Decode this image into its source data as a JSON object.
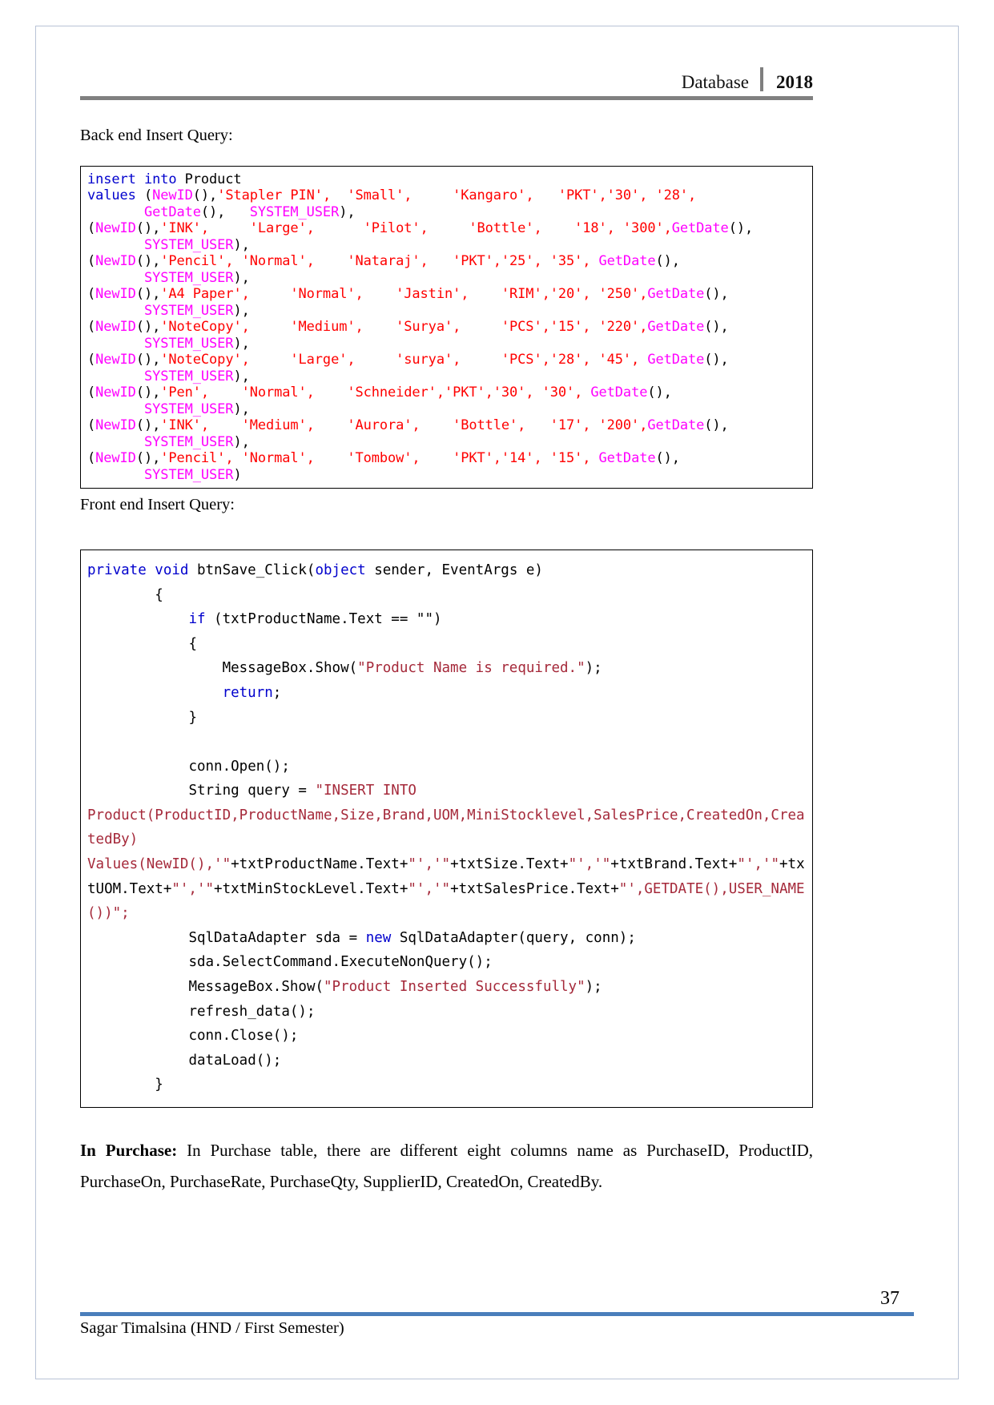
{
  "header": {
    "title": "Database",
    "year": "2018"
  },
  "sections": {
    "backend_caption": "Back end Insert Query:",
    "frontend_caption": "Front end Insert Query:"
  },
  "backend_code": {
    "language": "sql",
    "lines": [
      [
        {
          "t": "insert into ",
          "c": "kw"
        },
        {
          "t": "Product",
          "c": "plain"
        }
      ],
      [
        {
          "t": "values ",
          "c": "kw"
        },
        {
          "t": "(",
          "c": "plain"
        },
        {
          "t": "NewID",
          "c": "fn"
        },
        {
          "t": "(),",
          "c": "plain"
        },
        {
          "t": "'Stapler PIN',  'Small',     'Kangaro',   'PKT','30', '28',",
          "c": "str"
        }
      ],
      [
        {
          "t": "       ",
          "c": "plain"
        },
        {
          "t": "GetDate",
          "c": "fn"
        },
        {
          "t": "(),   ",
          "c": "plain"
        },
        {
          "t": "SYSTEM_USER",
          "c": "fn"
        },
        {
          "t": "),",
          "c": "plain"
        }
      ],
      [
        {
          "t": "(",
          "c": "plain"
        },
        {
          "t": "NewID",
          "c": "fn"
        },
        {
          "t": "(),",
          "c": "plain"
        },
        {
          "t": "'INK',     'Large',      'Pilot',     'Bottle',    '18', '300',",
          "c": "str"
        },
        {
          "t": "GetDate",
          "c": "fn"
        },
        {
          "t": "(),",
          "c": "plain"
        }
      ],
      [
        {
          "t": "       ",
          "c": "plain"
        },
        {
          "t": "SYSTEM_USER",
          "c": "fn"
        },
        {
          "t": "),",
          "c": "plain"
        }
      ],
      [
        {
          "t": "(",
          "c": "plain"
        },
        {
          "t": "NewID",
          "c": "fn"
        },
        {
          "t": "(),",
          "c": "plain"
        },
        {
          "t": "'Pencil', 'Normal',    'Nataraj',   'PKT','25', '35', ",
          "c": "str"
        },
        {
          "t": "GetDate",
          "c": "fn"
        },
        {
          "t": "(),",
          "c": "plain"
        }
      ],
      [
        {
          "t": "       ",
          "c": "plain"
        },
        {
          "t": "SYSTEM_USER",
          "c": "fn"
        },
        {
          "t": "),",
          "c": "plain"
        }
      ],
      [
        {
          "t": "(",
          "c": "plain"
        },
        {
          "t": "NewID",
          "c": "fn"
        },
        {
          "t": "(),",
          "c": "plain"
        },
        {
          "t": "'A4 Paper',     'Normal',    'Jastin',    'RIM','20', '250',",
          "c": "str"
        },
        {
          "t": "GetDate",
          "c": "fn"
        },
        {
          "t": "(),",
          "c": "plain"
        }
      ],
      [
        {
          "t": "       ",
          "c": "plain"
        },
        {
          "t": "SYSTEM_USER",
          "c": "fn"
        },
        {
          "t": "),",
          "c": "plain"
        }
      ],
      [
        {
          "t": "(",
          "c": "plain"
        },
        {
          "t": "NewID",
          "c": "fn"
        },
        {
          "t": "(),",
          "c": "plain"
        },
        {
          "t": "'NoteCopy',     'Medium',    'Surya',     'PCS','15', '220',",
          "c": "str"
        },
        {
          "t": "GetDate",
          "c": "fn"
        },
        {
          "t": "(),",
          "c": "plain"
        }
      ],
      [
        {
          "t": "       ",
          "c": "plain"
        },
        {
          "t": "SYSTEM_USER",
          "c": "fn"
        },
        {
          "t": "),",
          "c": "plain"
        }
      ],
      [
        {
          "t": "(",
          "c": "plain"
        },
        {
          "t": "NewID",
          "c": "fn"
        },
        {
          "t": "(),",
          "c": "plain"
        },
        {
          "t": "'NoteCopy',     'Large',     'surya',     'PCS','28', '45', ",
          "c": "str"
        },
        {
          "t": "GetDate",
          "c": "fn"
        },
        {
          "t": "(),",
          "c": "plain"
        }
      ],
      [
        {
          "t": "       ",
          "c": "plain"
        },
        {
          "t": "SYSTEM_USER",
          "c": "fn"
        },
        {
          "t": "),",
          "c": "plain"
        }
      ],
      [
        {
          "t": "(",
          "c": "plain"
        },
        {
          "t": "NewID",
          "c": "fn"
        },
        {
          "t": "(),",
          "c": "plain"
        },
        {
          "t": "'Pen',    'Normal',    'Schneider','PKT','30', '30', ",
          "c": "str"
        },
        {
          "t": "GetDate",
          "c": "fn"
        },
        {
          "t": "(),",
          "c": "plain"
        }
      ],
      [
        {
          "t": "       ",
          "c": "plain"
        },
        {
          "t": "SYSTEM_USER",
          "c": "fn"
        },
        {
          "t": "),",
          "c": "plain"
        }
      ],
      [
        {
          "t": "(",
          "c": "plain"
        },
        {
          "t": "NewID",
          "c": "fn"
        },
        {
          "t": "(),",
          "c": "plain"
        },
        {
          "t": "'INK',    'Medium',    'Aurora',    'Bottle',   '17', '200',",
          "c": "str"
        },
        {
          "t": "GetDate",
          "c": "fn"
        },
        {
          "t": "(),",
          "c": "plain"
        }
      ],
      [
        {
          "t": "       ",
          "c": "plain"
        },
        {
          "t": "SYSTEM_USER",
          "c": "fn"
        },
        {
          "t": "),",
          "c": "plain"
        }
      ],
      [
        {
          "t": "(",
          "c": "plain"
        },
        {
          "t": "NewID",
          "c": "fn"
        },
        {
          "t": "(),",
          "c": "plain"
        },
        {
          "t": "'Pencil', 'Normal',    'Tombow',    'PKT','14', '15', ",
          "c": "str"
        },
        {
          "t": "GetDate",
          "c": "fn"
        },
        {
          "t": "(),",
          "c": "plain"
        }
      ],
      [
        {
          "t": "       ",
          "c": "plain"
        },
        {
          "t": "SYSTEM_USER",
          "c": "fn"
        },
        {
          "t": ")",
          "c": "plain"
        }
      ]
    ]
  },
  "frontend_code": {
    "language": "csharp",
    "lines": [
      [
        {
          "t": "private void ",
          "c": "kw"
        },
        {
          "t": "btnSave_Click(",
          "c": "plain"
        },
        {
          "t": "object",
          "c": "kw"
        },
        {
          "t": " sender, EventArgs e)",
          "c": "plain"
        }
      ],
      [
        {
          "t": "        {",
          "c": "plain"
        }
      ],
      [
        {
          "t": "            ",
          "c": "plain"
        },
        {
          "t": "if",
          "c": "kw"
        },
        {
          "t": " (txtProductName.Text == \"\")",
          "c": "plain"
        }
      ],
      [
        {
          "t": "            {",
          "c": "plain"
        }
      ],
      [
        {
          "t": "                MessageBox.Show(",
          "c": "plain"
        },
        {
          "t": "\"Product Name is required.\"",
          "c": "cstr"
        },
        {
          "t": ");",
          "c": "plain"
        }
      ],
      [
        {
          "t": "                ",
          "c": "plain"
        },
        {
          "t": "return",
          "c": "kw"
        },
        {
          "t": ";",
          "c": "plain"
        }
      ],
      [
        {
          "t": "            }",
          "c": "plain"
        }
      ],
      [
        {
          "t": "",
          "c": "plain"
        }
      ],
      [
        {
          "t": "            conn.Open();",
          "c": "plain"
        }
      ],
      [
        {
          "t": "            String query = ",
          "c": "plain"
        },
        {
          "t": "\"INSERT INTO Product(ProductID,ProductName,Size,Brand,UOM,MiniStocklevel,SalesPrice,CreatedOn,CreatedBy)",
          "c": "cstr"
        }
      ],
      [
        {
          "t": "Values(NewID(),'\"",
          "c": "cstr"
        },
        {
          "t": "+txtProductName.Text+",
          "c": "plain"
        },
        {
          "t": "\"','\"",
          "c": "cstr"
        },
        {
          "t": "+txtSize.Text+",
          "c": "plain"
        },
        {
          "t": "\"','\"",
          "c": "cstr"
        },
        {
          "t": "+txtBrand.Text+",
          "c": "plain"
        },
        {
          "t": "\"','\"",
          "c": "cstr"
        },
        {
          "t": "+txtUOM.Text+",
          "c": "plain"
        },
        {
          "t": "\"','\"",
          "c": "cstr"
        },
        {
          "t": "+txtMinStockLevel.Text+",
          "c": "plain"
        },
        {
          "t": "\"','\"",
          "c": "cstr"
        },
        {
          "t": "+txtSalesPrice.Text+",
          "c": "plain"
        },
        {
          "t": "\"',GETDATE(),USER_NAME())\";",
          "c": "cstr"
        }
      ],
      [
        {
          "t": "            SqlDataAdapter sda = ",
          "c": "plain"
        },
        {
          "t": "new",
          "c": "kw"
        },
        {
          "t": " SqlDataAdapter(query, conn);",
          "c": "plain"
        }
      ],
      [
        {
          "t": "            sda.SelectCommand.ExecuteNonQuery();",
          "c": "plain"
        }
      ],
      [
        {
          "t": "            MessageBox.Show(",
          "c": "plain"
        },
        {
          "t": "\"Product Inserted Successfully\"",
          "c": "cstr"
        },
        {
          "t": ");",
          "c": "plain"
        }
      ],
      [
        {
          "t": "            refresh_data();",
          "c": "plain"
        }
      ],
      [
        {
          "t": "            conn.Close();",
          "c": "plain"
        }
      ],
      [
        {
          "t": "            dataLoad();",
          "c": "plain"
        }
      ],
      [
        {
          "t": "        }",
          "c": "plain"
        }
      ]
    ]
  },
  "closing": {
    "lead": "In Purchase:",
    "body": " In Purchase table, there are different eight columns name as PurchaseID, ProductID, PurchaseOn, PurchaseRate, PurchaseQty, SupplierID, CreatedOn, CreatedBy."
  },
  "footer": {
    "author": "Sagar Timalsina (HND / First Semester)",
    "page_number": "37"
  },
  "colors": {
    "header_rule": "#808080",
    "footer_rule": "#4a7ebb",
    "sql_keyword": "#0000cd",
    "sql_function": "#ff00ff",
    "sql_string": "#ff0000",
    "csharp_string": "#a5293a",
    "page_border": "#b9c3d6"
  }
}
